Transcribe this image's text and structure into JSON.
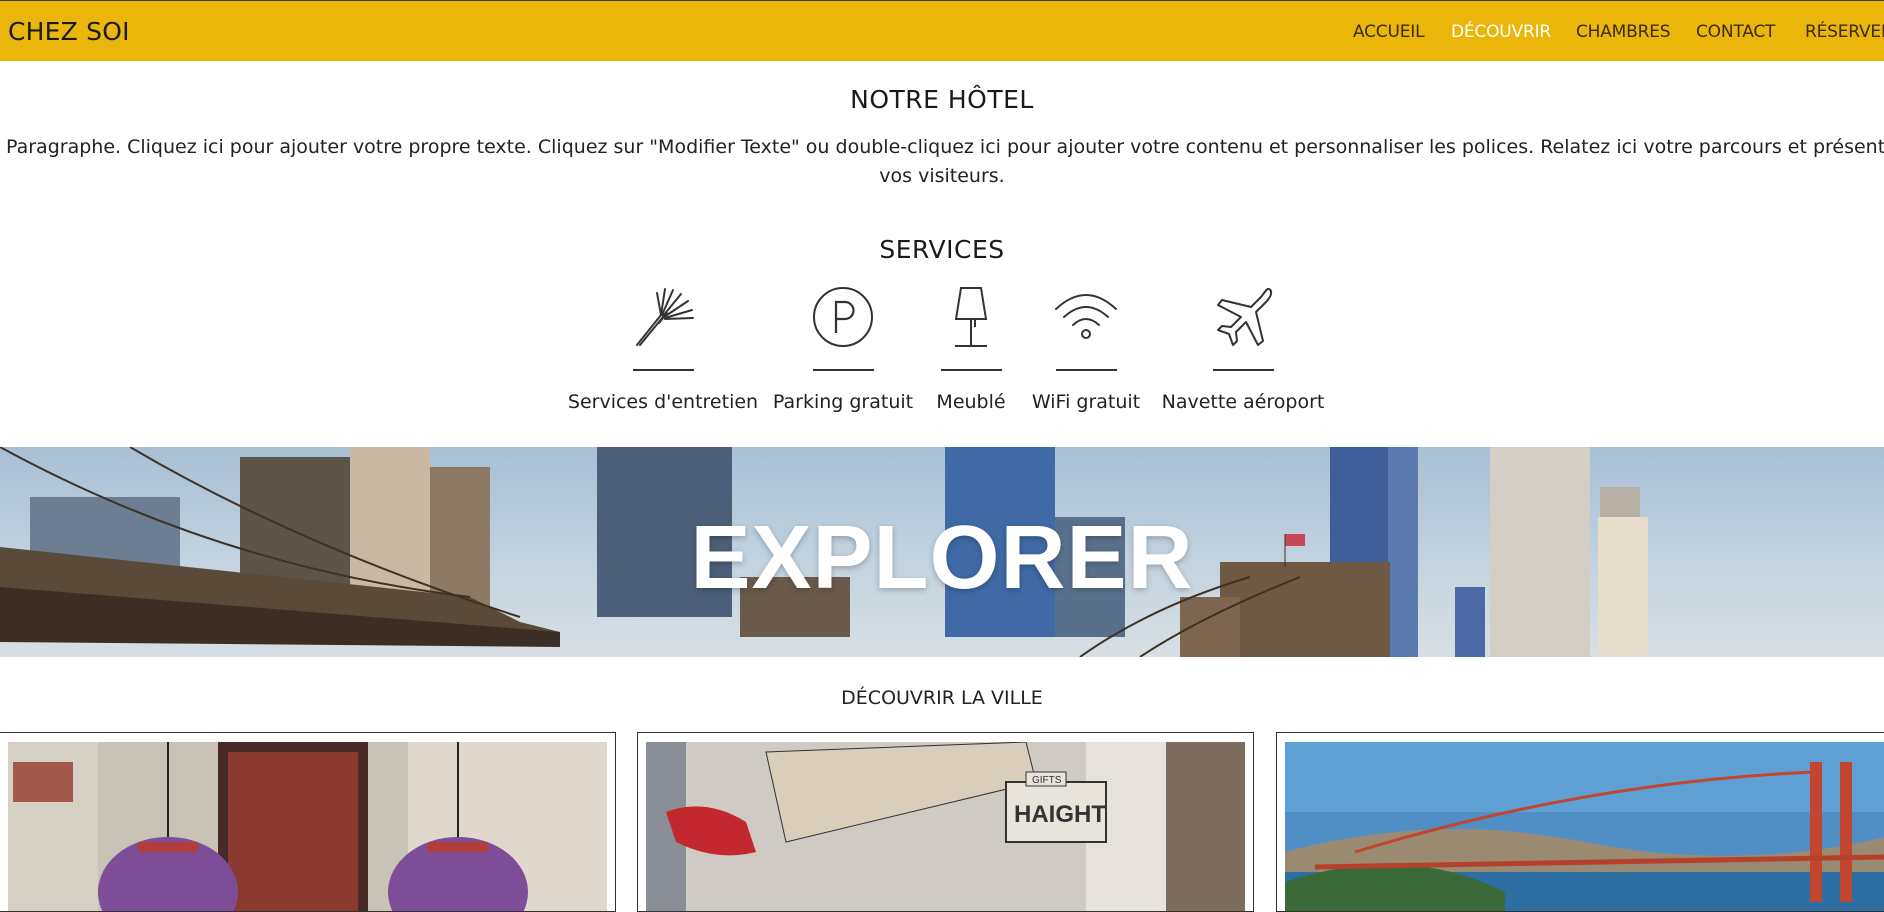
{
  "header": {
    "brand": "CHEZ SOI",
    "nav": [
      {
        "label": "ACCUEIL",
        "active": false
      },
      {
        "label": "DÉCOUVRIR",
        "active": true
      },
      {
        "label": "CHAMBRES",
        "active": false
      },
      {
        "label": "CONTACT",
        "active": false
      },
      {
        "label": "RÉSERVER",
        "active": false
      }
    ]
  },
  "hotel": {
    "title": "NOTRE HÔTEL",
    "paragraph_line1": "Paragraphe. Cliquez ici pour ajouter votre propre texte. Cliquez sur \"Modifier Texte\" ou double-cliquez ici pour ajouter votre contenu et personnaliser les polices. Relatez ici votre parcours et présentez votre activité à",
    "paragraph_line2": "vos visiteurs."
  },
  "services": {
    "title": "SERVICES",
    "items": [
      {
        "label": "Services d'entretien",
        "icon": "feather-duster-icon"
      },
      {
        "label": "Parking gratuit",
        "icon": "parking-icon"
      },
      {
        "label": "Meublé",
        "icon": "lamp-icon"
      },
      {
        "label": "WiFi gratuit",
        "icon": "wifi-icon"
      },
      {
        "label": "Navette aéroport",
        "icon": "airplane-icon"
      }
    ]
  },
  "banner": {
    "title": "EXPLORER"
  },
  "discover": {
    "title": "DÉCOUVRIR LA VILLE",
    "cards": [
      {
        "image": "chinatown-lanterns-image"
      },
      {
        "image": "haight-street-sign-image"
      },
      {
        "image": "golden-gate-bridge-image"
      }
    ]
  },
  "colors": {
    "nav_background": "#eab60a",
    "nav_active_text": "#ffffff",
    "text": "#222222"
  }
}
